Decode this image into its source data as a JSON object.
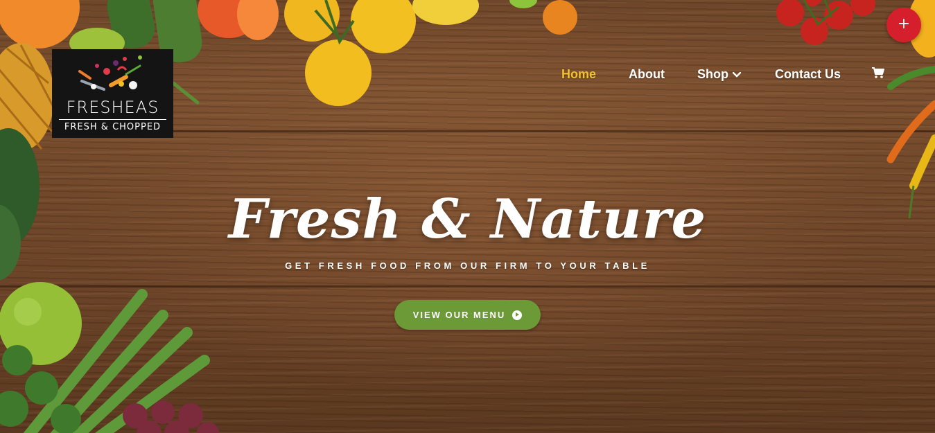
{
  "logo": {
    "title": "FRESHEAS",
    "subtitle": "FRESH & CHOPPED"
  },
  "nav": {
    "items": [
      {
        "label": "Home",
        "active": true
      },
      {
        "label": "About"
      },
      {
        "label": "Shop",
        "has_dropdown": true
      },
      {
        "label": "Contact Us"
      }
    ],
    "cart_icon": "shopping-cart-icon"
  },
  "floating_button": {
    "label": "+"
  },
  "hero": {
    "headline": "Fresh & Nature",
    "tagline": "GET FRESH FOOD FROM OUR FIRM TO YOUR TABLE",
    "cta_label": "VIEW OUR MENU",
    "cta_icon": "arrow-circle-right-icon"
  },
  "colors": {
    "nav_active": "#f2c12e",
    "cta_background": "#6c9a36",
    "fab_background": "#d61f2c",
    "logo_background": "#141414"
  }
}
